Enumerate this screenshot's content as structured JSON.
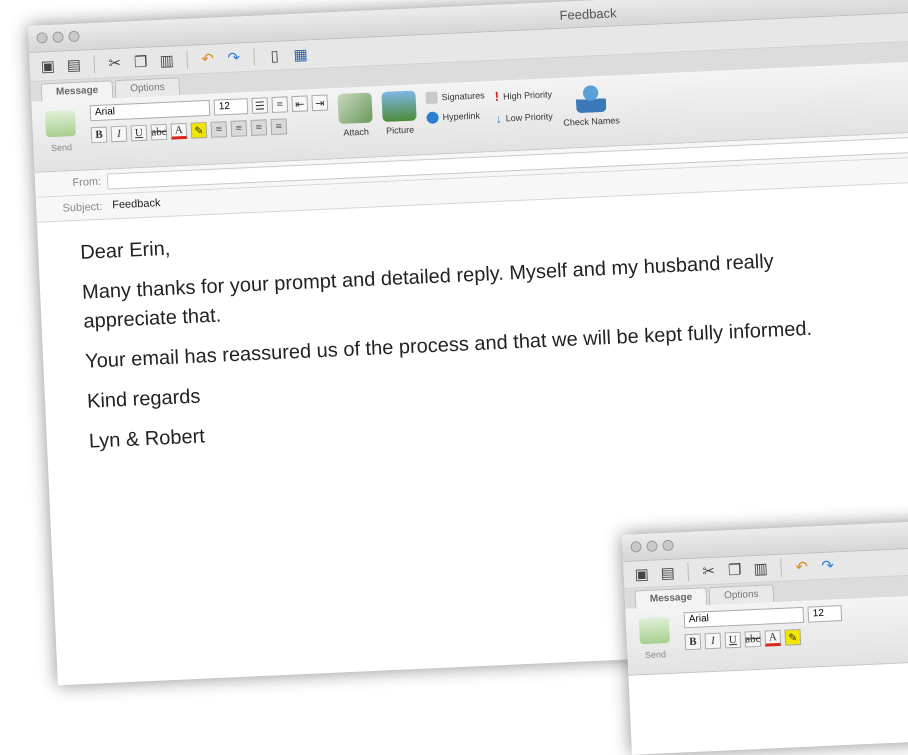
{
  "window": {
    "title": "Feedback",
    "tabs": [
      "Message",
      "Options"
    ],
    "ribbon": {
      "send_label": "Send",
      "font_name": "Arial",
      "font_size": "12",
      "attach_label": "Attach",
      "picture_label": "Picture",
      "signatures_label": "Signatures",
      "hyperlink_label": "Hyperlink",
      "high_priority_label": "High Priority",
      "low_priority_label": "Low Priority",
      "check_names_label": "Check Names"
    },
    "from_label": "From:",
    "from_value": "",
    "subject_label": "Subject:",
    "subject_value": "Feedback"
  },
  "message": {
    "greeting": "Dear Erin,",
    "paragraph1": "Many thanks for your prompt and detailed reply. Myself and my husband really appreciate that.",
    "paragraph2": "Your email has reassured us of the process and that we will be kept fully informed.",
    "closing": "Kind regards",
    "signature": "Lyn & Robert"
  },
  "mini_window": {
    "tabs": [
      "Message",
      "Options"
    ],
    "send_label": "Send",
    "font_name": "Arial",
    "font_size": "12"
  },
  "colors": {
    "font_color_underline": "#d9261c",
    "highlight": "#f2e600",
    "high_priority": "#d9261c",
    "low_priority": "#2f7fd0"
  }
}
